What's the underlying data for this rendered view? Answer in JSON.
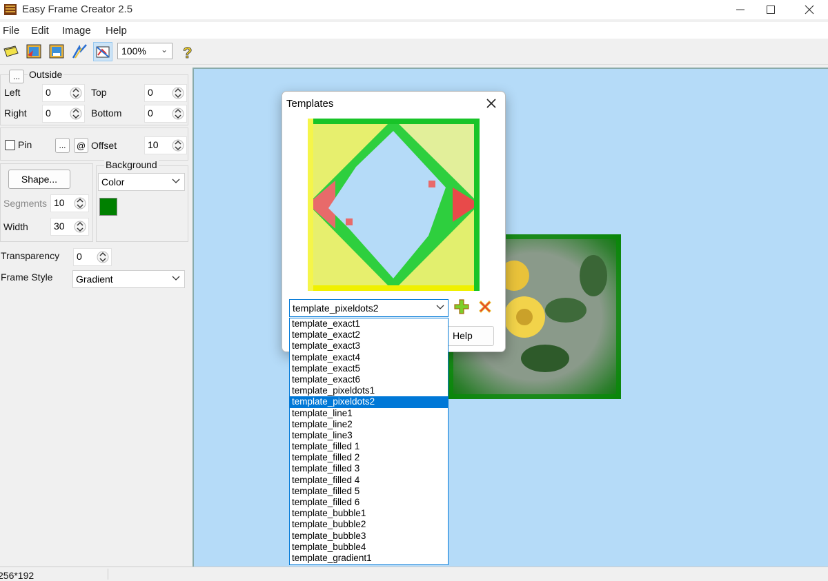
{
  "window": {
    "title": "Easy Frame Creator 2.5"
  },
  "menu": [
    "File",
    "Edit",
    "Image",
    "Help"
  ],
  "toolbar": {
    "zoom": "100%"
  },
  "outside": {
    "group_label": "Outside",
    "dots_button": "...",
    "left_label": "Left",
    "left_value": "0",
    "top_label": "Top",
    "top_value": "0",
    "right_label": "Right",
    "right_value": "0",
    "bottom_label": "Bottom",
    "bottom_value": "0"
  },
  "pin": {
    "label": "Pin",
    "checked": false,
    "dots_button": "...",
    "at_button": "@",
    "offset_label": "Offset",
    "offset_value": "10"
  },
  "shape": {
    "button_label": "Shape...",
    "segments_label": "Segments",
    "segments_value": "10",
    "width_label": "Width",
    "width_value": "30"
  },
  "background": {
    "group_label": "Background",
    "mode": "Color",
    "swatch_color": "#008000"
  },
  "transparency": {
    "label": "Transparency",
    "value": "0"
  },
  "frame_style": {
    "label": "Frame Style",
    "value": "Gradient"
  },
  "status": {
    "size": "256*192"
  },
  "dialog": {
    "title": "Templates",
    "selected": "template_pixeldots2",
    "help_label": "Help",
    "options": [
      "template_exact1",
      "template_exact2",
      "template_exact3",
      "template_exact4",
      "template_exact5",
      "template_exact6",
      "template_pixeldots1",
      "template_pixeldots2",
      "template_line1",
      "template_line2",
      "template_line3",
      "template_filled 1",
      "template_filled 2",
      "template_filled 3",
      "template_filled 4",
      "template_filled 5",
      "template_filled 6",
      "template_bubble1",
      "template_bubble2",
      "template_bubble3",
      "template_bubble4",
      "template_gradient1"
    ],
    "selected_index": 7
  },
  "colors": {
    "canvas_bg": "#b5dbf8",
    "accent": "#0078d7"
  }
}
